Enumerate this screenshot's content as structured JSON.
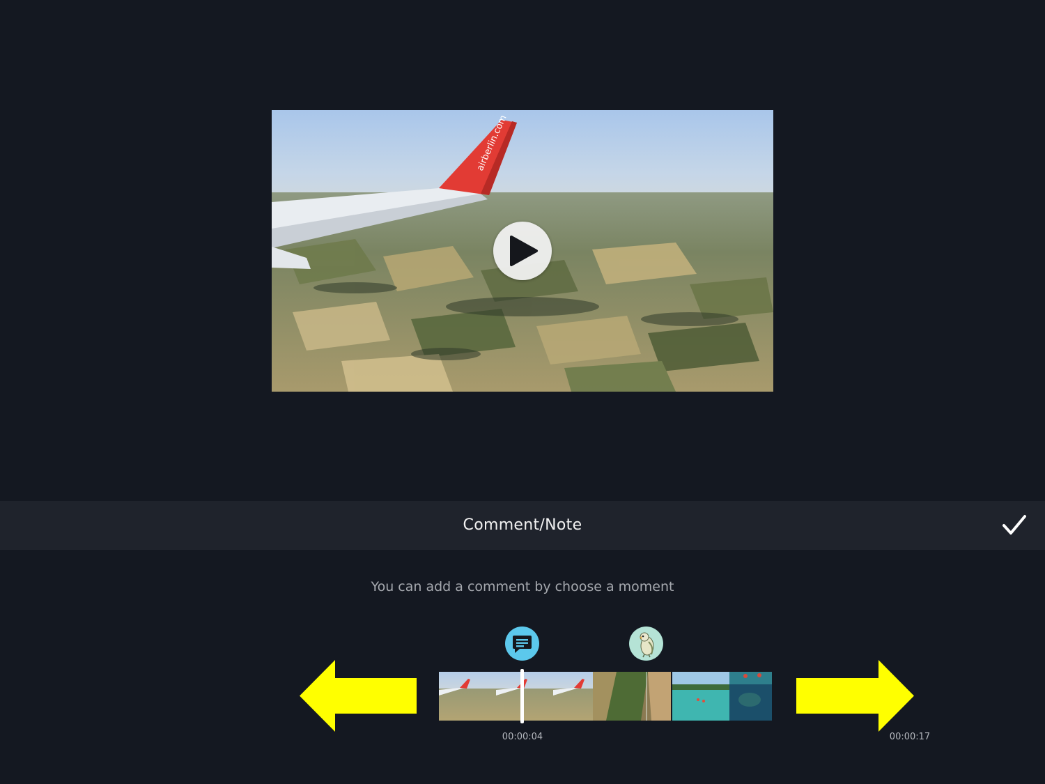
{
  "panel": {
    "title": "Comment/Note",
    "hint": "You can add a comment by choose a moment"
  },
  "video": {
    "wing_text": "airberlin.com"
  },
  "timeline": {
    "current_time": "00:00:04",
    "total_time": "00:00:17",
    "progress_fraction": 0.24
  },
  "colors": {
    "background": "#141821",
    "header_bar": "#1f232c",
    "accent_marker": "#5cc8ec",
    "arrow": "#ffff00"
  },
  "icons": {
    "play": "play-icon",
    "confirm": "checkmark-icon",
    "comment": "comment-bubble-icon",
    "sticker": "bird-sticker-icon",
    "arrow_left": "arrow-left-icon",
    "arrow_right": "arrow-right-icon"
  }
}
